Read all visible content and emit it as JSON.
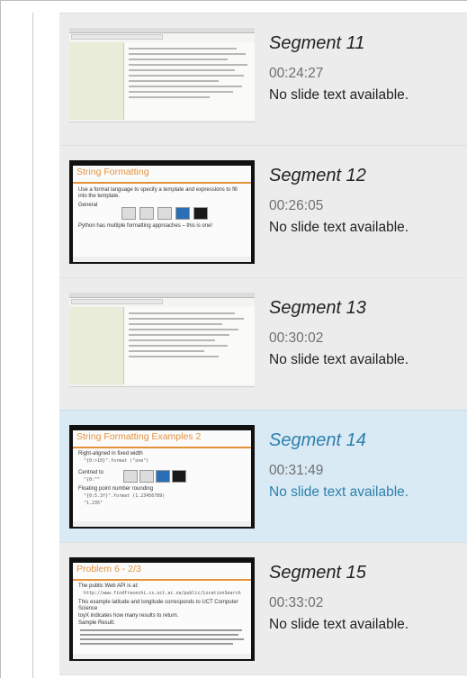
{
  "segments": [
    {
      "title": "Segment 11",
      "time": "00:24:27",
      "description": "No slide text available.",
      "thumbnail": "terminal-screenshot",
      "active": false
    },
    {
      "title": "Segment 12",
      "time": "00:26:05",
      "description": "No slide text available.",
      "thumbnail": "slide",
      "slide": {
        "title": "String Formatting",
        "bullets": [
          "Use a format language to specify a template and expressions to fill into the template.",
          "General",
          "Python has multiple formatting approaches – this is one!"
        ]
      },
      "active": false
    },
    {
      "title": "Segment 13",
      "time": "00:30:02",
      "description": "No slide text available.",
      "thumbnail": "terminal-screenshot",
      "active": false
    },
    {
      "title": "Segment 14",
      "time": "00:31:49",
      "description": "No slide text available.",
      "thumbnail": "slide",
      "slide": {
        "title": "String Formatting Examples 2",
        "bullets": [
          "Right-aligned in fixed width",
          "Centred to",
          "Floating point number rounding"
        ],
        "code": [
          "\"{0:>10}\".format (\"one\")",
          "\"{0:^\"",
          "\"{0:5.3f}\".format (1.23456789)",
          "\"1.235\""
        ]
      },
      "active": true
    },
    {
      "title": "Segment 15",
      "time": "00:33:02",
      "description": "No slide text available.",
      "thumbnail": "slide",
      "slide": {
        "title": "Problem 6 - 2/3",
        "bullets": [
          "The public Web API is at:",
          "This example latitude and longitude corresponds to UCT Computer Science",
          "toyX indicates how many results to return.",
          "Sample Result:"
        ]
      },
      "active": false
    }
  ],
  "colors": {
    "active_bg": "#d9eaf4",
    "active_text": "#2d7fad",
    "slide_accent": "#e4923a",
    "segment_bg": "#ececec"
  }
}
